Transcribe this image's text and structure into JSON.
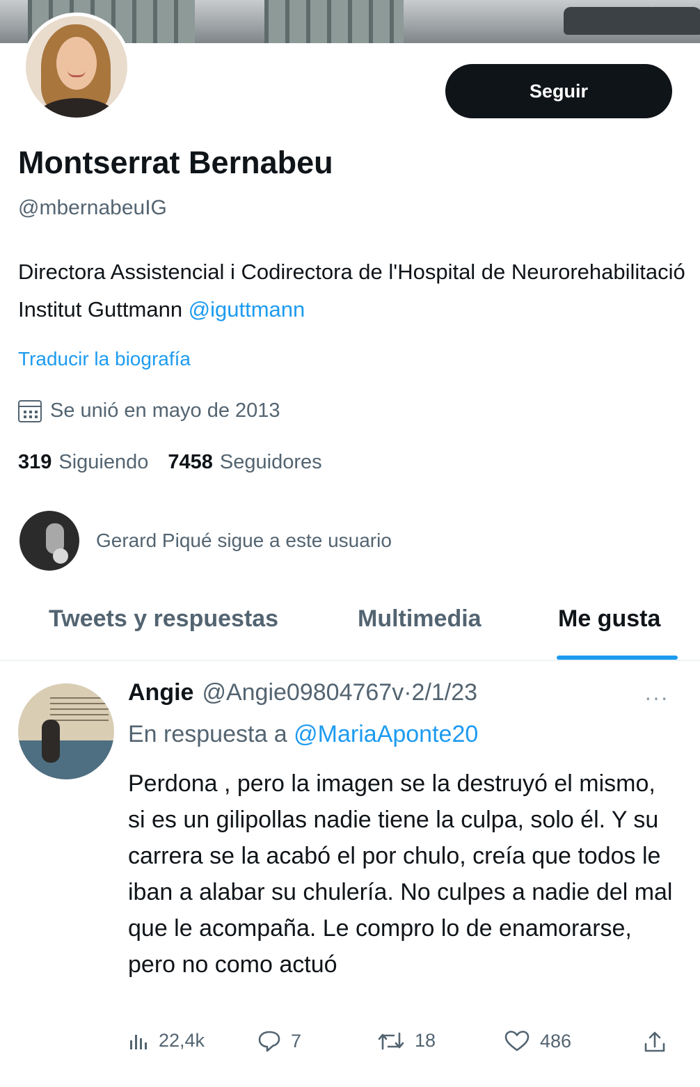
{
  "profile": {
    "display_name": "Montserrat Bernabeu",
    "handle": "@mbernabeuIG",
    "follow_label": "Seguir",
    "bio_text": "Directora Assistencial i Codirectora de l'Hospital de Neurorehabilitació Institut Guttmann ",
    "bio_mention": "@iguttmann",
    "translate_label": "Traducir la biografía",
    "joined": "Se unió en mayo de 2013",
    "following_count": "319",
    "following_label": "Siguiendo",
    "followers_count": "7458",
    "followers_label": "Seguidores",
    "followed_by": "Gerard Piqué sigue a este usuario"
  },
  "tabs": [
    {
      "label": "Tweets y respuestas",
      "active": false
    },
    {
      "label": "Multimedia",
      "active": false
    },
    {
      "label": "Me gusta",
      "active": true
    }
  ],
  "tweet": {
    "author_name": "Angie",
    "author_handle": "@Angie09804767v",
    "separator": "·",
    "date": "2/1/23",
    "reply_prefix": "En respuesta a ",
    "reply_mention": "@MariaAponte20",
    "text": "Perdona , pero la imagen se la destruyó el mismo, si es un gilipollas nadie tiene la culpa, solo él. Y su carrera se la acabó el por chulo, creía que todos le iban a alabar su chulería. No culpes a nadie del mal que le acompaña. Le compro lo de enamorarse, pero no como actuó",
    "views": "22,4k",
    "replies": "7",
    "retweets": "18",
    "likes": "486"
  },
  "colors": {
    "accent": "#1d9bf0",
    "text": "#0f1419",
    "muted": "#536471",
    "button_bg": "#0f1419"
  },
  "icons": [
    "calendar-icon",
    "more-icon",
    "views-icon",
    "reply-icon",
    "retweet-icon",
    "like-icon",
    "share-icon"
  ]
}
